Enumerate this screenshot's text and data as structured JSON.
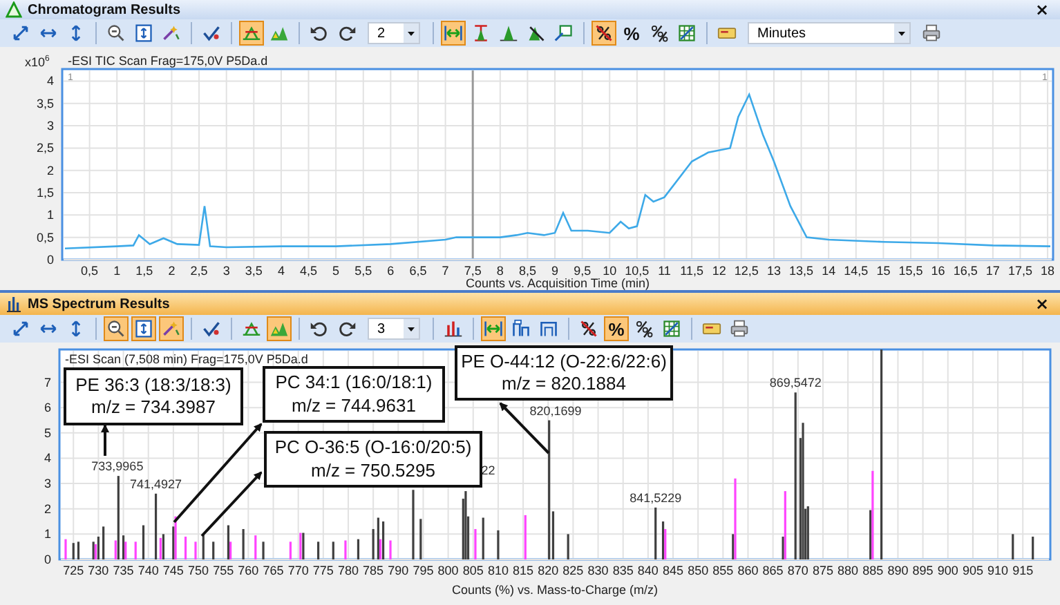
{
  "panels": [
    {
      "title": "Chromatogram Results",
      "active": false,
      "close": "×",
      "toolbar": [
        {
          "kind": "button",
          "on": false
        },
        {
          "kind": "button",
          "on": false
        },
        {
          "kind": "button",
          "on": false
        },
        {
          "kind": "separator"
        },
        {
          "kind": "button",
          "on": false
        },
        {
          "kind": "button",
          "on": false
        },
        {
          "kind": "button",
          "on": false
        },
        {
          "kind": "separator"
        },
        {
          "kind": "button",
          "on": false
        },
        {
          "kind": "separator"
        },
        {
          "kind": "button",
          "on": true
        },
        {
          "kind": "button",
          "on": false
        },
        {
          "kind": "separator"
        },
        {
          "kind": "button",
          "on": false
        },
        {
          "kind": "button",
          "on": false
        },
        {
          "kind": "dropdown",
          "value": "2"
        },
        {
          "kind": "separator"
        },
        {
          "kind": "button",
          "on": true
        },
        {
          "kind": "button",
          "on": false
        },
        {
          "kind": "button",
          "on": false
        },
        {
          "kind": "button",
          "on": false
        },
        {
          "kind": "button",
          "on": false
        },
        {
          "kind": "separator"
        },
        {
          "kind": "button",
          "on": true
        },
        {
          "kind": "text",
          "label": "%",
          "on": false
        },
        {
          "kind": "button",
          "on": false
        },
        {
          "kind": "button",
          "on": false
        },
        {
          "kind": "separator"
        },
        {
          "kind": "button",
          "on": false
        },
        {
          "kind": "dropdown",
          "value": "Minutes"
        },
        {
          "kind": "button",
          "on": false
        }
      ],
      "multiplier": "x10$^{6}$",
      "chart_data": {
        "type": "line",
        "title": "-ESI TIC Scan Frag=175,0V P5Da.d",
        "xlabel": "Counts vs. Acquisition Time (min)",
        "x": [
          0.05,
          1,
          1.3,
          1.4,
          1.6,
          1.85,
          2.1,
          2.5,
          2.6,
          2.7,
          3,
          4,
          5,
          6,
          7,
          7.2,
          7.5,
          8,
          8.3,
          8.5,
          8.8,
          9,
          9.15,
          9.3,
          9.6,
          10,
          10.2,
          10.35,
          10.5,
          10.65,
          10.8,
          11,
          11.5,
          11.8,
          12.2,
          12.35,
          12.55,
          12.8,
          13,
          13.3,
          13.6,
          14,
          15,
          16,
          17,
          18.05
        ],
        "series": [
          {
            "color": "#3da9e8",
            "values": [
              0.25,
              0.3,
              0.32,
              0.55,
              0.35,
              0.48,
              0.35,
              0.33,
              1.2,
              0.3,
              0.28,
              0.3,
              0.3,
              0.35,
              0.45,
              0.5,
              0.5,
              0.5,
              0.55,
              0.6,
              0.55,
              0.6,
              1.05,
              0.65,
              0.65,
              0.6,
              0.85,
              0.7,
              0.75,
              1.45,
              1.3,
              1.4,
              2.2,
              2.4,
              2.5,
              3.2,
              3.7,
              2.8,
              2.2,
              1.2,
              0.5,
              0.45,
              0.4,
              0.37,
              0.32,
              0.3
            ]
          }
        ],
        "xlim": [
          0,
          18.1
        ],
        "ylim": [
          0,
          4.27
        ],
        "xticks": [
          {
            "value": 0.5,
            "label": "0,5"
          },
          {
            "value": 1,
            "label": "1"
          },
          {
            "value": 1.5,
            "label": "1,5"
          },
          {
            "value": 2,
            "label": "2"
          },
          {
            "value": 2.5,
            "label": "2,5"
          },
          {
            "value": 3,
            "label": "3"
          },
          {
            "value": 3.5,
            "label": "3,5"
          },
          {
            "value": 4,
            "label": "4"
          },
          {
            "value": 4.5,
            "label": "4,5"
          },
          {
            "value": 5,
            "label": "5"
          },
          {
            "value": 5.5,
            "label": "5,5"
          },
          {
            "value": 6,
            "label": "6"
          },
          {
            "value": 6.5,
            "label": "6,5"
          },
          {
            "value": 7,
            "label": "7"
          },
          {
            "value": 7.5,
            "label": "7,5"
          },
          {
            "value": 8,
            "label": "8"
          },
          {
            "value": 8.5,
            "label": "8,5"
          },
          {
            "value": 9,
            "label": "9"
          },
          {
            "value": 9.5,
            "label": "9,5"
          },
          {
            "value": 10,
            "label": "10"
          },
          {
            "value": 10.5,
            "label": "10,5"
          },
          {
            "value": 11,
            "label": "11"
          },
          {
            "value": 11.5,
            "label": "11,5"
          },
          {
            "value": 12,
            "label": "12"
          },
          {
            "value": 12.5,
            "label": "12,5"
          },
          {
            "value": 13,
            "label": "13"
          },
          {
            "value": 13.5,
            "label": "13,5"
          },
          {
            "value": 14,
            "label": "14"
          },
          {
            "value": 14.5,
            "label": "14,5"
          },
          {
            "value": 15,
            "label": "15"
          },
          {
            "value": 15.5,
            "label": "15,5"
          },
          {
            "value": 16,
            "label": "16"
          },
          {
            "value": 16.5,
            "label": "16,5"
          },
          {
            "value": 17,
            "label": "17"
          },
          {
            "value": 17.5,
            "label": "17,5"
          },
          {
            "value": 18,
            "label": "18"
          }
        ],
        "yticks": [
          {
            "value": 0,
            "label": "0"
          },
          {
            "value": 0.5,
            "label": "0,5"
          },
          {
            "value": 1,
            "label": "1"
          },
          {
            "value": 1.5,
            "label": "1,5"
          },
          {
            "value": 2,
            "label": "2"
          },
          {
            "value": 2.5,
            "label": "2,5"
          },
          {
            "value": 3,
            "label": "3"
          },
          {
            "value": 3.5,
            "label": "3,5"
          },
          {
            "value": 4,
            "label": "4"
          }
        ],
        "grid": true,
        "ref_lines": [
          {
            "axis": "x",
            "value": 7.5
          }
        ]
      },
      "trace_markers": [
        "1",
        "1"
      ]
    },
    {
      "title": "MS Spectrum Results",
      "active": true,
      "close": "×",
      "toolbar": [
        {
          "kind": "button",
          "on": false
        },
        {
          "kind": "button",
          "on": false
        },
        {
          "kind": "button",
          "on": false
        },
        {
          "kind": "separator"
        },
        {
          "kind": "button",
          "on": true
        },
        {
          "kind": "button",
          "on": true
        },
        {
          "kind": "button",
          "on": true
        },
        {
          "kind": "separator"
        },
        {
          "kind": "button",
          "on": false
        },
        {
          "kind": "separator"
        },
        {
          "kind": "button",
          "on": false
        },
        {
          "kind": "button",
          "on": true
        },
        {
          "kind": "separator"
        },
        {
          "kind": "button",
          "on": false
        },
        {
          "kind": "button",
          "on": false
        },
        {
          "kind": "dropdown",
          "value": "3"
        },
        {
          "kind": "separator"
        },
        {
          "kind": "button",
          "on": false
        },
        {
          "kind": "separator"
        },
        {
          "kind": "button",
          "on": true
        },
        {
          "kind": "button",
          "on": false
        },
        {
          "kind": "button",
          "on": false
        },
        {
          "kind": "separator"
        },
        {
          "kind": "button",
          "on": false
        },
        {
          "kind": "text",
          "label": "%",
          "on": true
        },
        {
          "kind": "button",
          "on": false
        },
        {
          "kind": "button",
          "on": false
        },
        {
          "kind": "separator"
        },
        {
          "kind": "button",
          "on": false
        },
        {
          "kind": "button",
          "on": false
        }
      ],
      "chart_data": {
        "type": "bar",
        "title": "-ESI Scan (7,508 min) Frag=175,0V P5Da.d",
        "xlabel": "Counts (%) vs. Mass-to-Charge (m/z)",
        "x": [
          723,
          725,
          726,
          729,
          730,
          731,
          733,
          734,
          735,
          737,
          739,
          741.5,
          742,
          743,
          745,
          747,
          749,
          751,
          753,
          756,
          759,
          761,
          763,
          768,
          770,
          771,
          774,
          777,
          779,
          782,
          785,
          786,
          787,
          788,
          793,
          794.5,
          803,
          803.5,
          804,
          805,
          807,
          810,
          815,
          820.2,
          821,
          824,
          841.5,
          843,
          857,
          867,
          869.5,
          870.5,
          871,
          871.5,
          872,
          884.5,
          886.7,
          913,
          917
        ],
        "series": [
          {
            "color": "#404040",
            "values": [
              null,
              0.65,
              0.7,
              0.7,
              0.9,
              1.3,
              null,
              3.3,
              0.95,
              null,
              1.35,
              2.6,
              null,
              1.0,
              1.3,
              null,
              null,
              1.0,
              0.7,
              1.35,
              1.2,
              null,
              0.7,
              null,
              null,
              1.05,
              0.7,
              0.7,
              null,
              0.8,
              1.2,
              1.65,
              1.5,
              null,
              2.75,
              1.6,
              2.4,
              2.7,
              1.7,
              null,
              1.65,
              1.15,
              null,
              5.5,
              1.9,
              1.0,
              2.05,
              1.5,
              1.0,
              0.9,
              6.6,
              4.8,
              5.4,
              2.0,
              2.1,
              1.95,
              8.3,
              1.0,
              0.9
            ]
          },
          {
            "color": "#ff44ff",
            "values": [
              0.8,
              null,
              null,
              0.6,
              null,
              null,
              0.75,
              null,
              0.7,
              0.7,
              null,
              null,
              0.85,
              null,
              1.7,
              0.9,
              0.7,
              null,
              null,
              0.7,
              null,
              0.95,
              null,
              0.7,
              1.05,
              null,
              null,
              null,
              0.75,
              null,
              null,
              0.8,
              null,
              0.75,
              null,
              null,
              null,
              null,
              null,
              1.2,
              null,
              null,
              1.75,
              null,
              null,
              null,
              null,
              1.2,
              3.2,
              2.7,
              null,
              null,
              null,
              null,
              null,
              3.5,
              null,
              null,
              null
            ]
          }
        ],
        "xlim": [
          722.2,
          920.5
        ],
        "ylim": [
          0,
          8.3
        ],
        "xticks": [
          725,
          730,
          735,
          740,
          745,
          750,
          755,
          760,
          765,
          770,
          775,
          780,
          785,
          790,
          795,
          800,
          805,
          810,
          815,
          820,
          825,
          830,
          835,
          840,
          845,
          850,
          855,
          860,
          865,
          870,
          875,
          880,
          885,
          890,
          895,
          900,
          905,
          910,
          915
        ],
        "yticks": [
          0,
          1,
          2,
          3,
          4,
          5,
          6,
          7
        ],
        "grid": true
      },
      "peak_labels": [
        "733,9965",
        "741,4927",
        "22",
        "820,1699",
        "841,5229",
        "869,5472"
      ],
      "callouts": [
        {
          "name": "PE 36:3 (18:3/18:3)",
          "mass": "m/z = 734.3987"
        },
        {
          "name": "PC 34:1 (16:0/18:1)",
          "mass": "m/z = 744.9631"
        },
        {
          "name": "PC O-36:5 (O-16:0/20:5)",
          "mass": "m/z = 750.5295"
        },
        {
          "name": "PE O-44:12 (O-22:6/22:6)",
          "mass": "m/z = 820.1884"
        }
      ]
    }
  ]
}
